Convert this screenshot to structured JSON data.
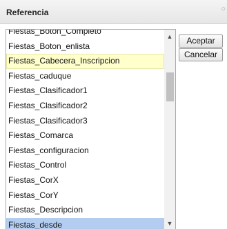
{
  "dialog": {
    "title": "Referencia",
    "close_icon": "close-icon"
  },
  "list": {
    "items": [
      "Fiestas_Boton_Completo",
      "Fiestas_Boton_enlista",
      "Fiestas_Cabecera_Inscripcion",
      "Fiestas_caduque",
      "Fiestas_Clasificador1",
      "Fiestas_Clasificador2",
      "Fiestas_Clasificador3",
      "Fiestas_Comarca",
      "Fiestas_configuracion",
      "Fiestas_Control",
      "Fiestas_CorX",
      "Fiestas_CorY",
      "Fiestas_Descripcion",
      "Fiestas_desde"
    ],
    "hovered_item": "Fiestas_Cabecera_Inscripcion",
    "selected_item": "Fiestas_desde"
  },
  "buttons": {
    "accept_label": "Aceptar",
    "cancel_label": "Cancelar"
  },
  "colors": {
    "hover_bg": "#ffffcc",
    "selected_bg": "#b3cdf0",
    "titlebar_bg": "#e6e6e6"
  }
}
